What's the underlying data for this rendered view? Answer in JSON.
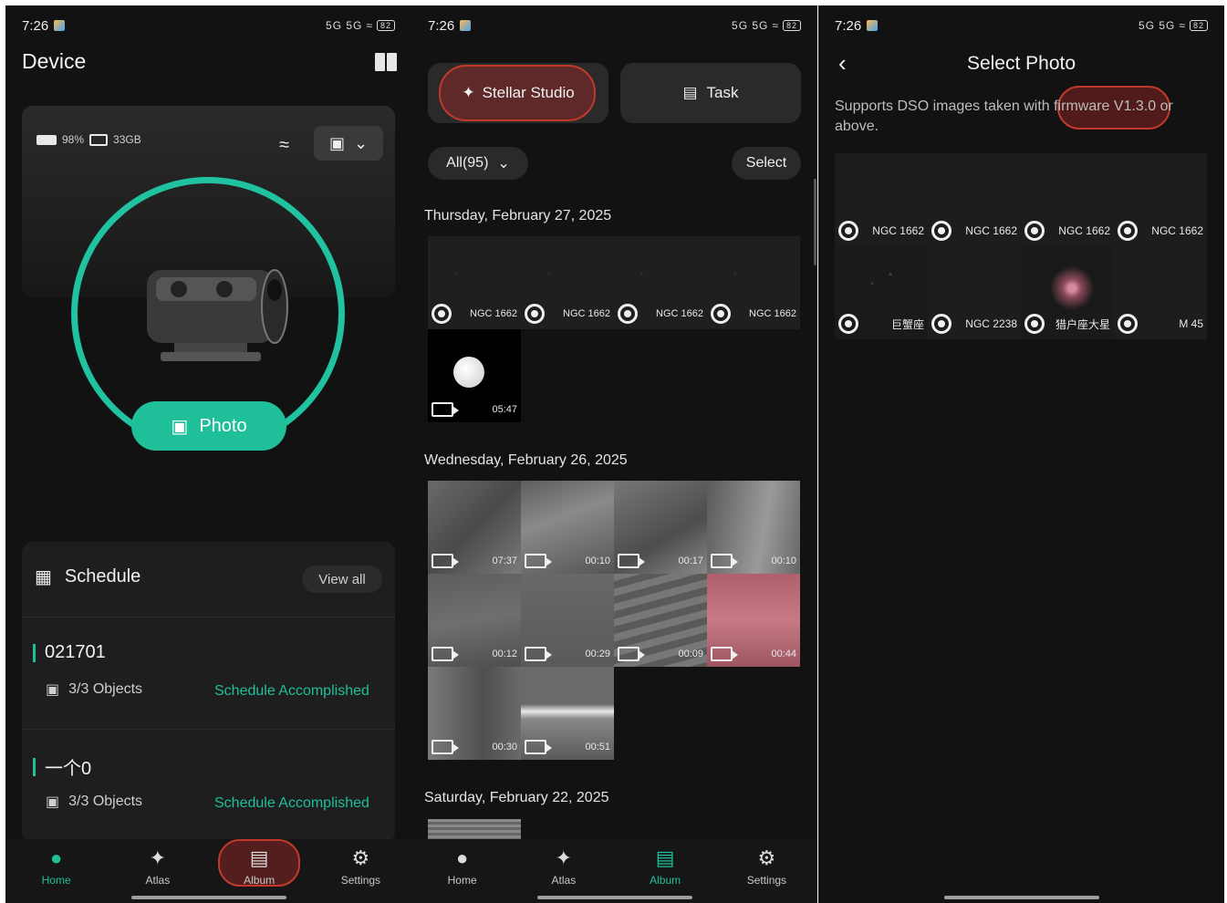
{
  "status_bar": {
    "time": "7:26",
    "signal_text": "5G 5G",
    "battery": "82"
  },
  "panel_device": {
    "title": "Device",
    "book_icon": "book-icon",
    "battery_pct": "98%",
    "storage": "33GB",
    "photo_button": "Photo",
    "schedule": {
      "title": "Schedule",
      "view_all": "View all",
      "items": [
        {
          "name": "021701",
          "objects": "3/3 Objects",
          "status": "Schedule Accomplished"
        },
        {
          "name": "一个0",
          "objects": "3/3 Objects",
          "status": "Schedule Accomplished"
        }
      ]
    },
    "nav": [
      {
        "label": "Home",
        "icon": "planet-icon",
        "active": true
      },
      {
        "label": "Atlas",
        "icon": "constellation-icon",
        "active": false
      },
      {
        "label": "Album",
        "icon": "image-icon",
        "active": false
      },
      {
        "label": "Settings",
        "icon": "gear-icon",
        "active": false
      }
    ]
  },
  "panel_album": {
    "stellar_studio": "Stellar Studio",
    "task": "Task",
    "filter": "All(95)",
    "select": "Select",
    "sections": [
      {
        "date": "Thursday, February 27, 2025",
        "items": [
          {
            "type": "photo",
            "label": "NGC 1662"
          },
          {
            "type": "photo",
            "label": "NGC 1662"
          },
          {
            "type": "photo",
            "label": "NGC 1662"
          },
          {
            "type": "photo",
            "label": "NGC 1662"
          },
          {
            "type": "video",
            "label": "05:47"
          }
        ]
      },
      {
        "date": "Wednesday, February 26, 2025",
        "items": [
          {
            "type": "video",
            "label": "07:37"
          },
          {
            "type": "video",
            "label": "00:10"
          },
          {
            "type": "video",
            "label": "00:17"
          },
          {
            "type": "video",
            "label": "00:10"
          },
          {
            "type": "video",
            "label": "00:12"
          },
          {
            "type": "video",
            "label": "00:29"
          },
          {
            "type": "video",
            "label": "00:09"
          },
          {
            "type": "video",
            "label": "00:44"
          },
          {
            "type": "video",
            "label": "00:30"
          },
          {
            "type": "video",
            "label": "00:51"
          }
        ]
      },
      {
        "date": "Saturday, February 22, 2025",
        "items": []
      }
    ],
    "nav": [
      {
        "label": "Home",
        "icon": "planet-icon",
        "active": false
      },
      {
        "label": "Atlas",
        "icon": "constellation-icon",
        "active": false
      },
      {
        "label": "Album",
        "icon": "image-icon",
        "active": true
      },
      {
        "label": "Settings",
        "icon": "gear-icon",
        "active": false
      }
    ]
  },
  "panel_select": {
    "title": "Select Photo",
    "note": "Supports DSO images taken with firmware V1.3.0 or above.",
    "items": [
      "NGC 1662",
      "NGC 1662",
      "NGC 1662",
      "NGC 1662",
      "巨蟹座",
      "NGC 2238",
      "猎户座大星",
      "M 45"
    ]
  },
  "colors": {
    "accent": "#1fbf9a",
    "highlight": "#c0392b",
    "background": "#121212"
  }
}
